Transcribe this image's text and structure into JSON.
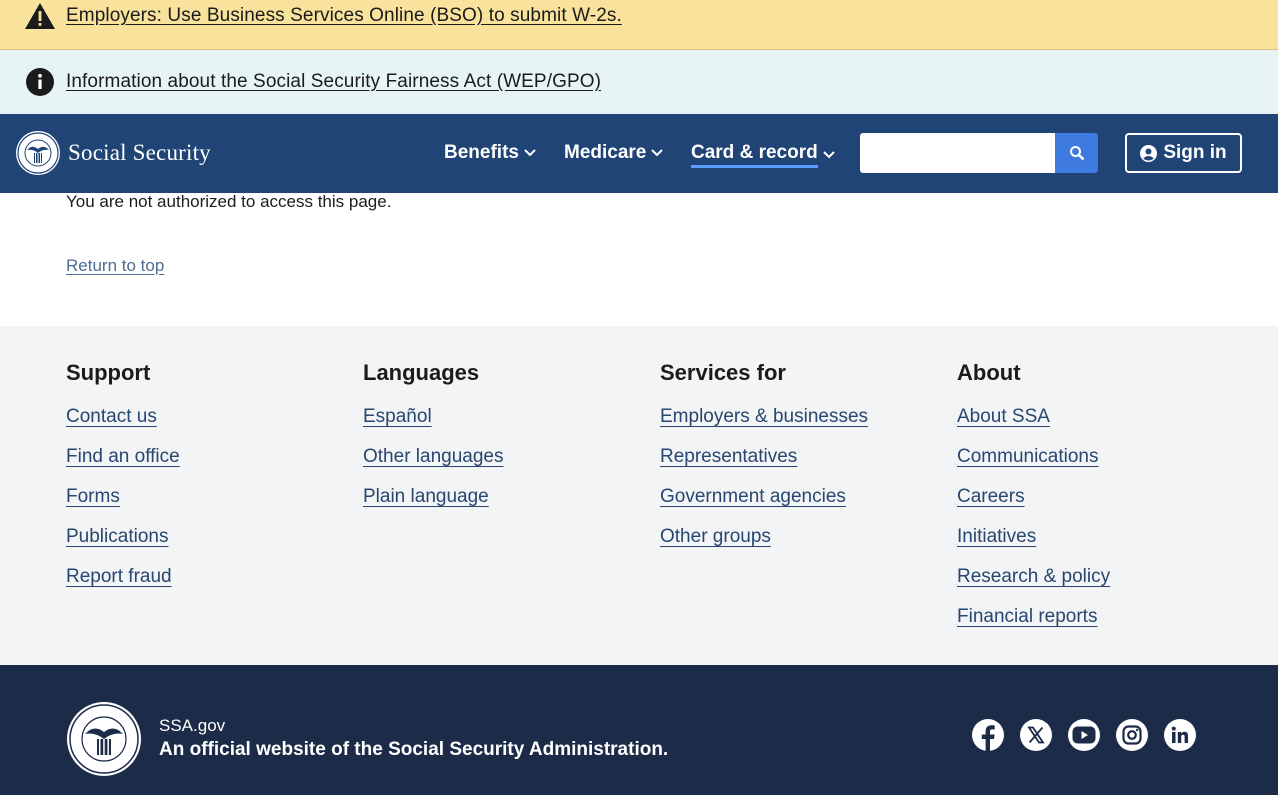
{
  "alerts": {
    "warning": {
      "text": "Employers: Use Business Services Online (BSO) to submit W-2s.",
      "icon": "warning-icon"
    },
    "info": {
      "text": "Information about the Social Security Fairness Act (WEP/GPO)",
      "icon": "info-icon"
    }
  },
  "header": {
    "brand": "Social Security",
    "nav": [
      {
        "label": "Benefits"
      },
      {
        "label": "Medicare"
      },
      {
        "label": "Card & record",
        "active": true
      }
    ],
    "search": {
      "placeholder": "",
      "value": ""
    },
    "signin_label": "Sign in"
  },
  "main": {
    "message": "You are not authorized to access this page.",
    "return_top": "Return to top"
  },
  "footer": {
    "columns": [
      {
        "heading": "Support",
        "links": [
          "Contact us",
          "Find an office",
          "Forms",
          "Publications",
          "Report fraud"
        ]
      },
      {
        "heading": "Languages",
        "links": [
          "Español",
          "Other languages",
          "Plain language"
        ]
      },
      {
        "heading": "Services for",
        "links": [
          "Employers & businesses",
          "Representatives",
          "Government agencies",
          "Other groups"
        ]
      },
      {
        "heading": "About",
        "links": [
          "About SSA",
          "Communications",
          "Careers",
          "Initiatives",
          "Research & policy",
          "Financial reports"
        ]
      }
    ],
    "site": "SSA.gov",
    "official": "An official website of the Social Security Administration.",
    "socials": [
      "facebook-icon",
      "x-icon",
      "youtube-icon",
      "instagram-icon",
      "linkedin-icon"
    ]
  },
  "colors": {
    "warning_bg": "#f9e29c",
    "info_bg": "#e7f4f6",
    "navbar": "#1f4475",
    "search_btn": "#3f7ae0",
    "footer_light": "#f3f4f6",
    "footer_dark": "#1b2b48",
    "link": "#28466f"
  }
}
